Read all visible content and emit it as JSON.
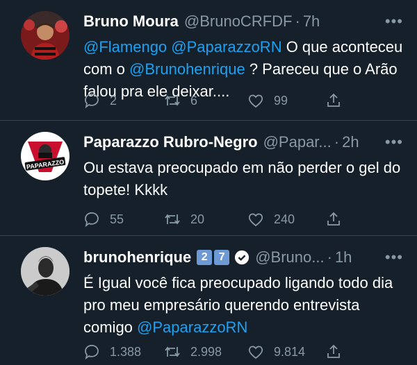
{
  "tweets": [
    {
      "name": "Bruno Moura",
      "handle": "@BrunoCRFDF",
      "time": "7h",
      "text_parts": [
        {
          "t": "@Flamengo",
          "link": true
        },
        {
          "t": " ",
          "link": false
        },
        {
          "t": "@PaparazzoRN",
          "link": true
        },
        {
          "t": " O que aconteceu com o ",
          "link": false
        },
        {
          "t": "@Brunohenrique",
          "link": true
        },
        {
          "t": " ? Pareceu que o Arão falou pra ele deixar....",
          "link": false
        }
      ],
      "replies": "2",
      "retweets": "6",
      "likes": "99"
    },
    {
      "name": "Paparazzo Rubro-Negro",
      "handle": "@Papar...",
      "time": "2h",
      "text_parts": [
        {
          "t": "Ou estava preocupado em não perder o gel do topete! Kkkk",
          "link": false
        }
      ],
      "replies": "55",
      "retweets": "20",
      "likes": "240",
      "avatar_logo_text": "PAPARAZZO"
    },
    {
      "name": "brunohenrique",
      "emoji_1": "2",
      "emoji_2": "7",
      "handle": "@Bruno...",
      "time": "1h",
      "text_parts": [
        {
          "t": "É Igual você fica preocupado ligando todo dia pro meu empresário querendo entrevista comigo ",
          "link": false
        },
        {
          "t": "@PaparazzoRN",
          "link": true
        }
      ],
      "replies": "1.388",
      "retweets": "2.998",
      "likes": "9.814"
    }
  ],
  "colors": {
    "background": "#15202b",
    "link": "#1da1f2",
    "muted": "#8899a6",
    "text": "#ffffff"
  },
  "icons": [
    "reply-icon",
    "retweet-icon",
    "like-icon",
    "share-icon",
    "more-icon",
    "verified-icon"
  ]
}
